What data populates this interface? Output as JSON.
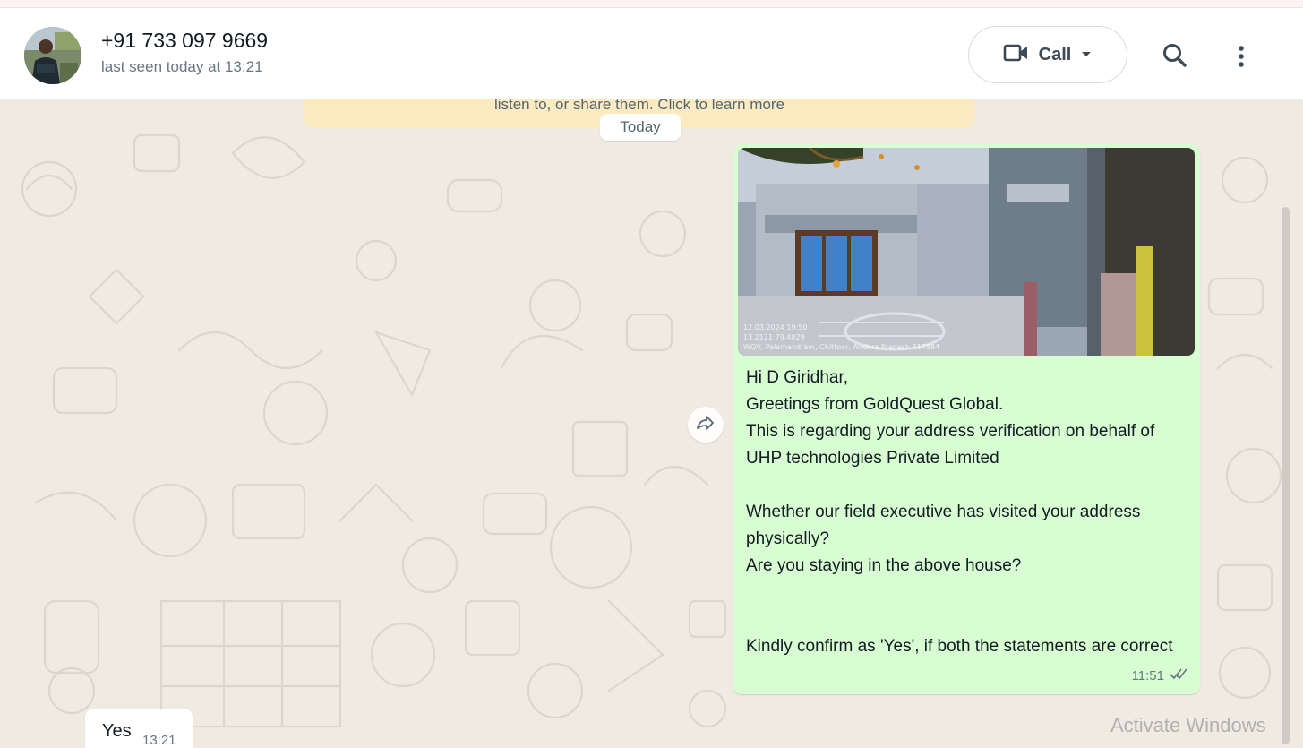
{
  "header": {
    "contact_name": "+91 733 097 9669",
    "last_seen": "last seen today at 13:21",
    "call_label": "Call",
    "avatar_icon": "avatar-photo",
    "search_icon": "search-icon",
    "menu_icon": "more-vertical-icon"
  },
  "chat": {
    "encryption_banner": "listen to, or share them. Click to learn more",
    "date_chip": "Today",
    "outgoing_message": {
      "text": "Hi D Giridhar,\nGreetings from GoldQuest Global.\nThis is regarding your address verification on behalf of UHP technologies Private Limited\n\nWhether our field executive has visited your address physically?\nAre you staying in the above house?\n\n\nKindly confirm as 'Yes', if both the statements are correct",
      "time": "11:51",
      "status": "read",
      "image_overlay": "12.03.2024 19:50\n13.2121 79.4029\nWQV, Palamandram, Chittoor, Andhra Pradesh 517584"
    },
    "incoming_message": {
      "text": "Yes",
      "time": "13:21"
    }
  },
  "watermark": "Activate Windows",
  "colors": {
    "chat_bg": "#efeae2",
    "outgoing_bubble": "#d9fdd3",
    "incoming_bubble": "#ffffff",
    "banner": "#fcebc1"
  }
}
